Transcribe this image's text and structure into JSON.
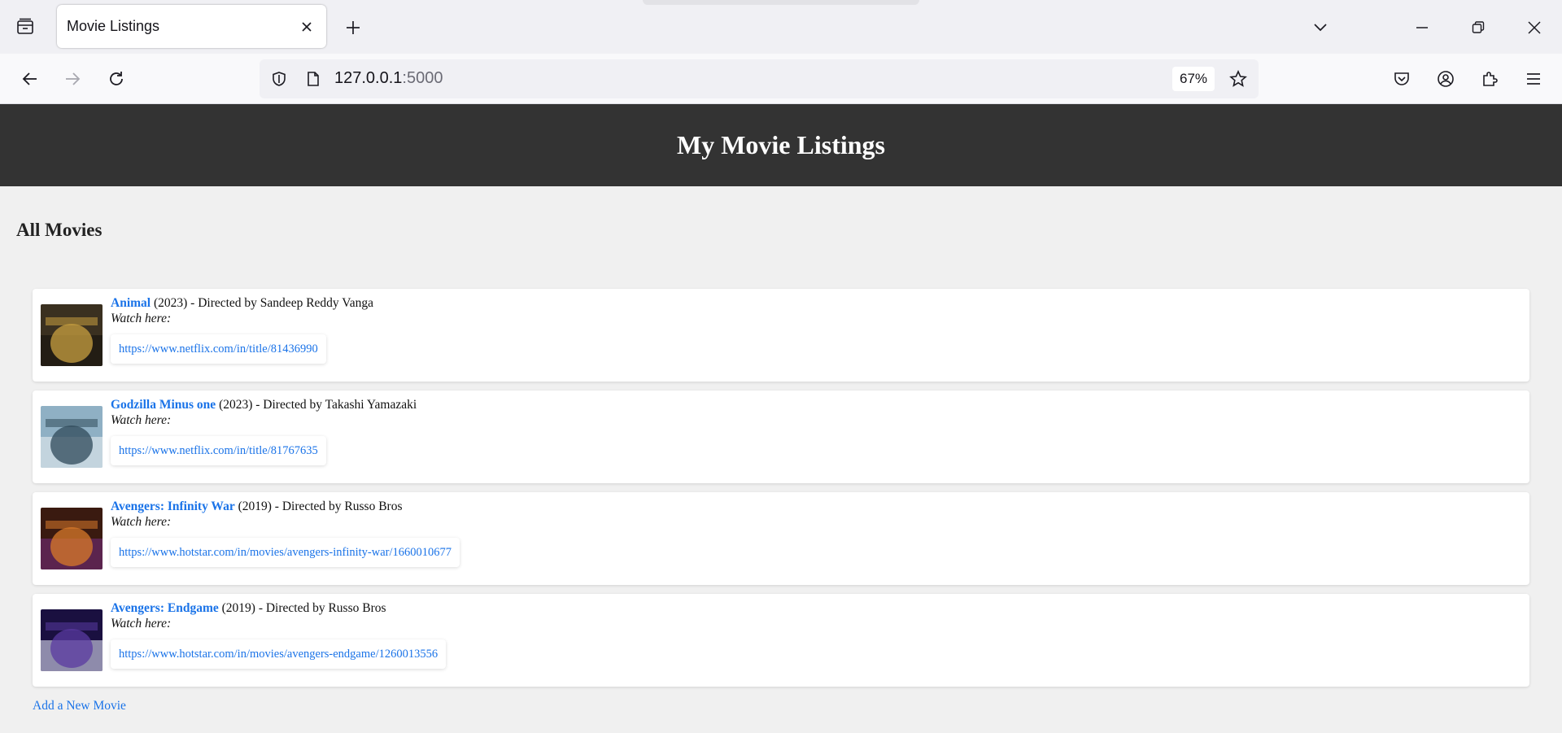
{
  "browser": {
    "tab_title": "Movie Listings",
    "url_host": "127.0.0.1",
    "url_port": ":5000",
    "zoom": "67%"
  },
  "site": {
    "title": "My Movie Listings",
    "section_title": "All Movies",
    "watch_label": "Watch here:",
    "add_link": "Add a New Movie"
  },
  "movies": [
    {
      "title": "Animal",
      "meta": " (2023) - Directed by Sandeep Reddy Vanga",
      "url": "https://www.netflix.com/in/title/81436990",
      "poster_colors": [
        "#3a3020",
        "#c9a040",
        "#1a1510"
      ]
    },
    {
      "title": "Godzilla Minus one",
      "meta": " (2023) - Directed by Takashi Yamazaki",
      "url": "https://www.netflix.com/in/title/81767635",
      "poster_colors": [
        "#8fb0c4",
        "#2f4a5a",
        "#d8e4ea"
      ]
    },
    {
      "title": "Avengers: Infinity War",
      "meta": " (2019) - Directed by Russo Bros",
      "url": "https://www.hotstar.com/in/movies/avengers-infinity-war/1660010677",
      "poster_colors": [
        "#3a1a10",
        "#d87a2a",
        "#6a2a6a"
      ]
    },
    {
      "title": "Avengers: Endgame",
      "meta": " (2019) - Directed by Russo Bros",
      "url": "https://www.hotstar.com/in/movies/avengers-endgame/1260013556",
      "poster_colors": [
        "#1a1040",
        "#5a3aa0",
        "#c0c0d8"
      ]
    }
  ]
}
